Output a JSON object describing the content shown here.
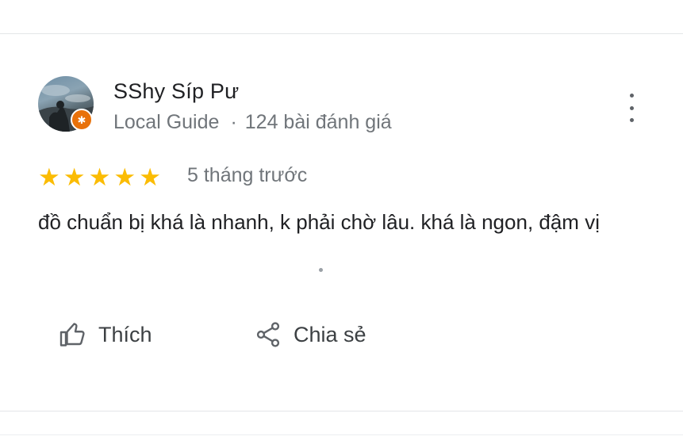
{
  "reviewer": {
    "name": "SShy Síp Pư",
    "guide_label": "Local Guide",
    "separator": "·",
    "review_count": "124 bài đánh giá"
  },
  "rating": {
    "value": 5,
    "max": 5,
    "star_glyph": "★",
    "time_ago": "5 tháng trước"
  },
  "review": {
    "text": "đồ chuẩn bị khá là nhanh, k phải chờ lâu. khá là ngon, đậm vị"
  },
  "actions": {
    "like_label": "Thích",
    "share_label": "Chia sẻ"
  },
  "icons": {
    "more": "more-vertical-icon",
    "like": "thumbs-up-icon",
    "share": "share-icon",
    "badge": "local-guide-star-icon"
  },
  "colors": {
    "star": "#fbbc04",
    "badge": "#e8710a",
    "secondary_text": "#70757a"
  }
}
